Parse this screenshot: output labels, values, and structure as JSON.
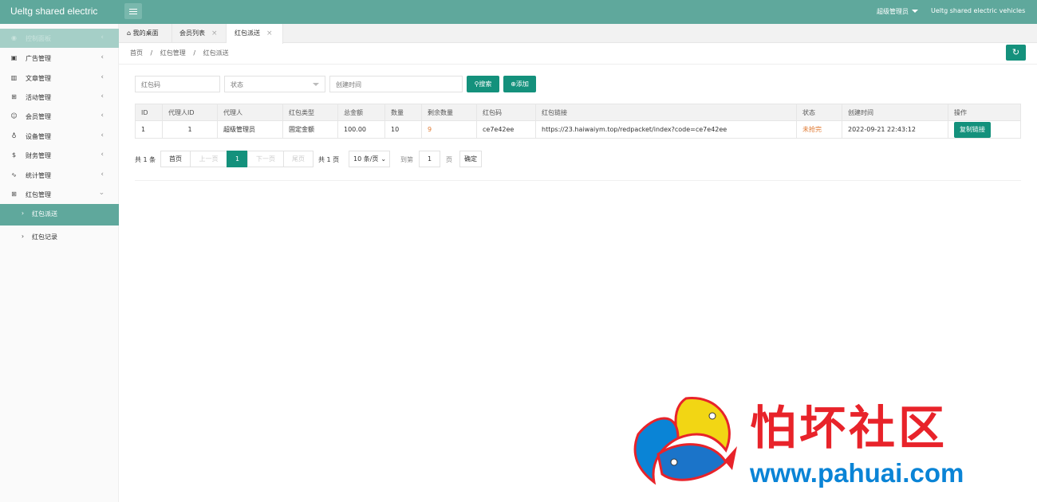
{
  "header": {
    "brand": "Ueltg shared electric",
    "user": "超级管理员",
    "site": "Ueltg shared electric vehicles"
  },
  "sidebar": {
    "items": [
      {
        "label": "控制面板",
        "icon": "dashboard-icon"
      },
      {
        "label": "广告管理",
        "icon": "image-icon"
      },
      {
        "label": "文章管理",
        "icon": "book-icon"
      },
      {
        "label": "活动管理",
        "icon": "gift-icon"
      },
      {
        "label": "会员管理",
        "icon": "user-icon"
      },
      {
        "label": "设备管理",
        "icon": "bike-icon"
      },
      {
        "label": "财务管理",
        "icon": "money-icon"
      },
      {
        "label": "统计管理",
        "icon": "pulse-icon"
      },
      {
        "label": "红包管理",
        "icon": "gift-icon"
      }
    ],
    "sub_items": [
      {
        "label": "红包派送"
      },
      {
        "label": "红包记录"
      }
    ]
  },
  "tabs": [
    {
      "label": "我的桌面"
    },
    {
      "label": "会员列表"
    },
    {
      "label": "红包派送"
    }
  ],
  "breadcrumb": [
    "首页",
    "/",
    "红包管理",
    "/",
    "红包派送"
  ],
  "filters": {
    "code_placeholder": "红包码",
    "status_placeholder": "状态",
    "time_placeholder": "创建时间",
    "search_label": "搜索",
    "add_label": "添加"
  },
  "table": {
    "headers": [
      "ID",
      "代理人ID",
      "代理人",
      "红包类型",
      "总金额",
      "数量",
      "剩余数量",
      "红包码",
      "红包链接",
      "状态",
      "创建时间",
      "操作"
    ],
    "rows": [
      {
        "id": "1",
        "agent_id": "1",
        "agent": "超级管理员",
        "type": "固定金额",
        "total": "100.00",
        "count": "10",
        "remaining": "9",
        "code": "ce7e42ee",
        "link": "https://23.haiwaiym.top/redpacket/index?code=ce7e42ee",
        "status": "未抢完",
        "created": "2022-09-21 22:43:12",
        "action": "复制链接"
      }
    ]
  },
  "pager": {
    "total": "共 1 条",
    "first": "首页",
    "prev": "上一页",
    "current": "1",
    "next": "下一页",
    "last": "尾页",
    "pages": "共 1 页",
    "size": "10 条/页",
    "goto": "到第",
    "goto_value": "1",
    "page_unit": "页",
    "confirm": "确定"
  },
  "watermark": {
    "text": "怕坏社区",
    "url": "www.pahuai.com"
  },
  "colors": {
    "header": "#5fa89c",
    "primary": "#14917c",
    "orange": "#e07a33",
    "watermark_red": "#e8232a",
    "watermark_blue": "#0a84d6"
  }
}
